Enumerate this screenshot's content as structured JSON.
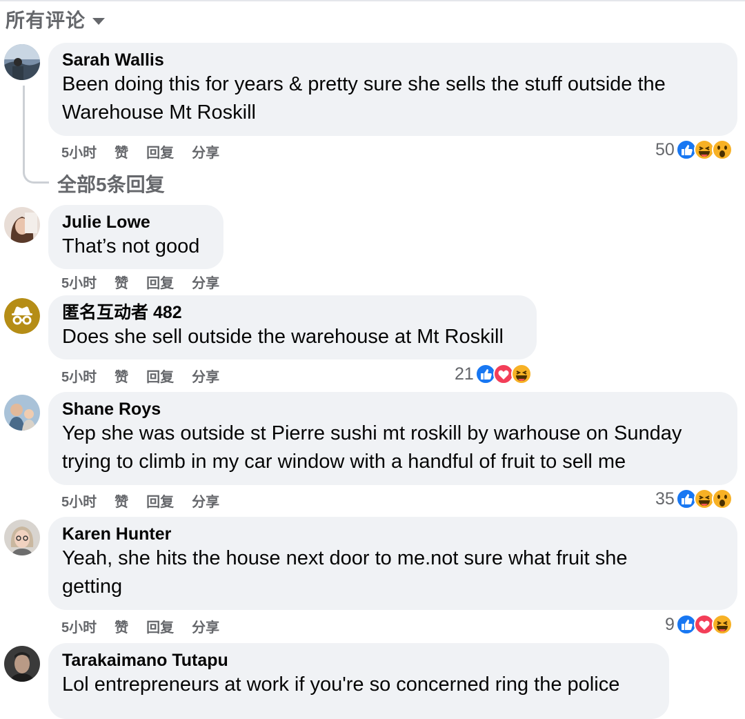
{
  "header": {
    "title": "所有评论"
  },
  "comments": [
    {
      "author": "Sarah Wallis",
      "text_lines": [
        "Been doing this for years & pretty sure she sells the stuff outside the",
        "Warehouse Mt Roskill"
      ],
      "actions": {
        "time": "5小时",
        "like": "赞",
        "reply": "回复",
        "share": "分享"
      },
      "reaction_count": "50",
      "reaction_icons": [
        "like-icon",
        "haha-icon",
        "wow-icon"
      ]
    },
    {
      "author": "Julie Lowe",
      "text_lines": [
        "That’s not good"
      ],
      "actions": {
        "time": "5小时",
        "like": "赞",
        "reply": "回复",
        "share": "分享"
      }
    },
    {
      "author": "匿名互动者 482",
      "text_lines": [
        "Does she sell outside the warehouse at Mt Roskill"
      ],
      "actions": {
        "time": "5小时",
        "like": "赞",
        "reply": "回复",
        "share": "分享"
      },
      "reaction_count": "21",
      "reaction_icons": [
        "like-icon",
        "love-icon",
        "haha-icon"
      ]
    },
    {
      "author": "Shane Roys",
      "text_lines": [
        "Yep she was outside st Pierre sushi mt roskill by warhouse on Sunday",
        "trying to climb in my car window with a handful of fruit to sell me"
      ],
      "actions": {
        "time": "5小时",
        "like": "赞",
        "reply": "回复",
        "share": "分享"
      },
      "reaction_count": "35",
      "reaction_icons": [
        "like-icon",
        "haha-icon",
        "wow-icon"
      ]
    },
    {
      "author": "Karen Hunter",
      "text_lines": [
        "Yeah, she hits the house next door to me.not sure what fruit she",
        "getting"
      ],
      "actions": {
        "time": "5小时",
        "like": "赞",
        "reply": "回复",
        "share": "分享"
      },
      "reaction_count": "9",
      "reaction_icons": [
        "like-icon",
        "love-icon",
        "haha-icon"
      ]
    },
    {
      "author": "Tarakaimano Tutapu",
      "text_lines": [
        "Lol entrepreneurs at work if you're so concerned ring the police"
      ]
    }
  ],
  "replies_link": "全部5条回复",
  "colors": {
    "bubble": "#f0f2f5",
    "secondary_text": "#65676b",
    "like_blue": "#1877f2",
    "love_red": "#f33e58",
    "haha_yellow": "#f7b125",
    "anon_avatar": "#b58d16"
  }
}
